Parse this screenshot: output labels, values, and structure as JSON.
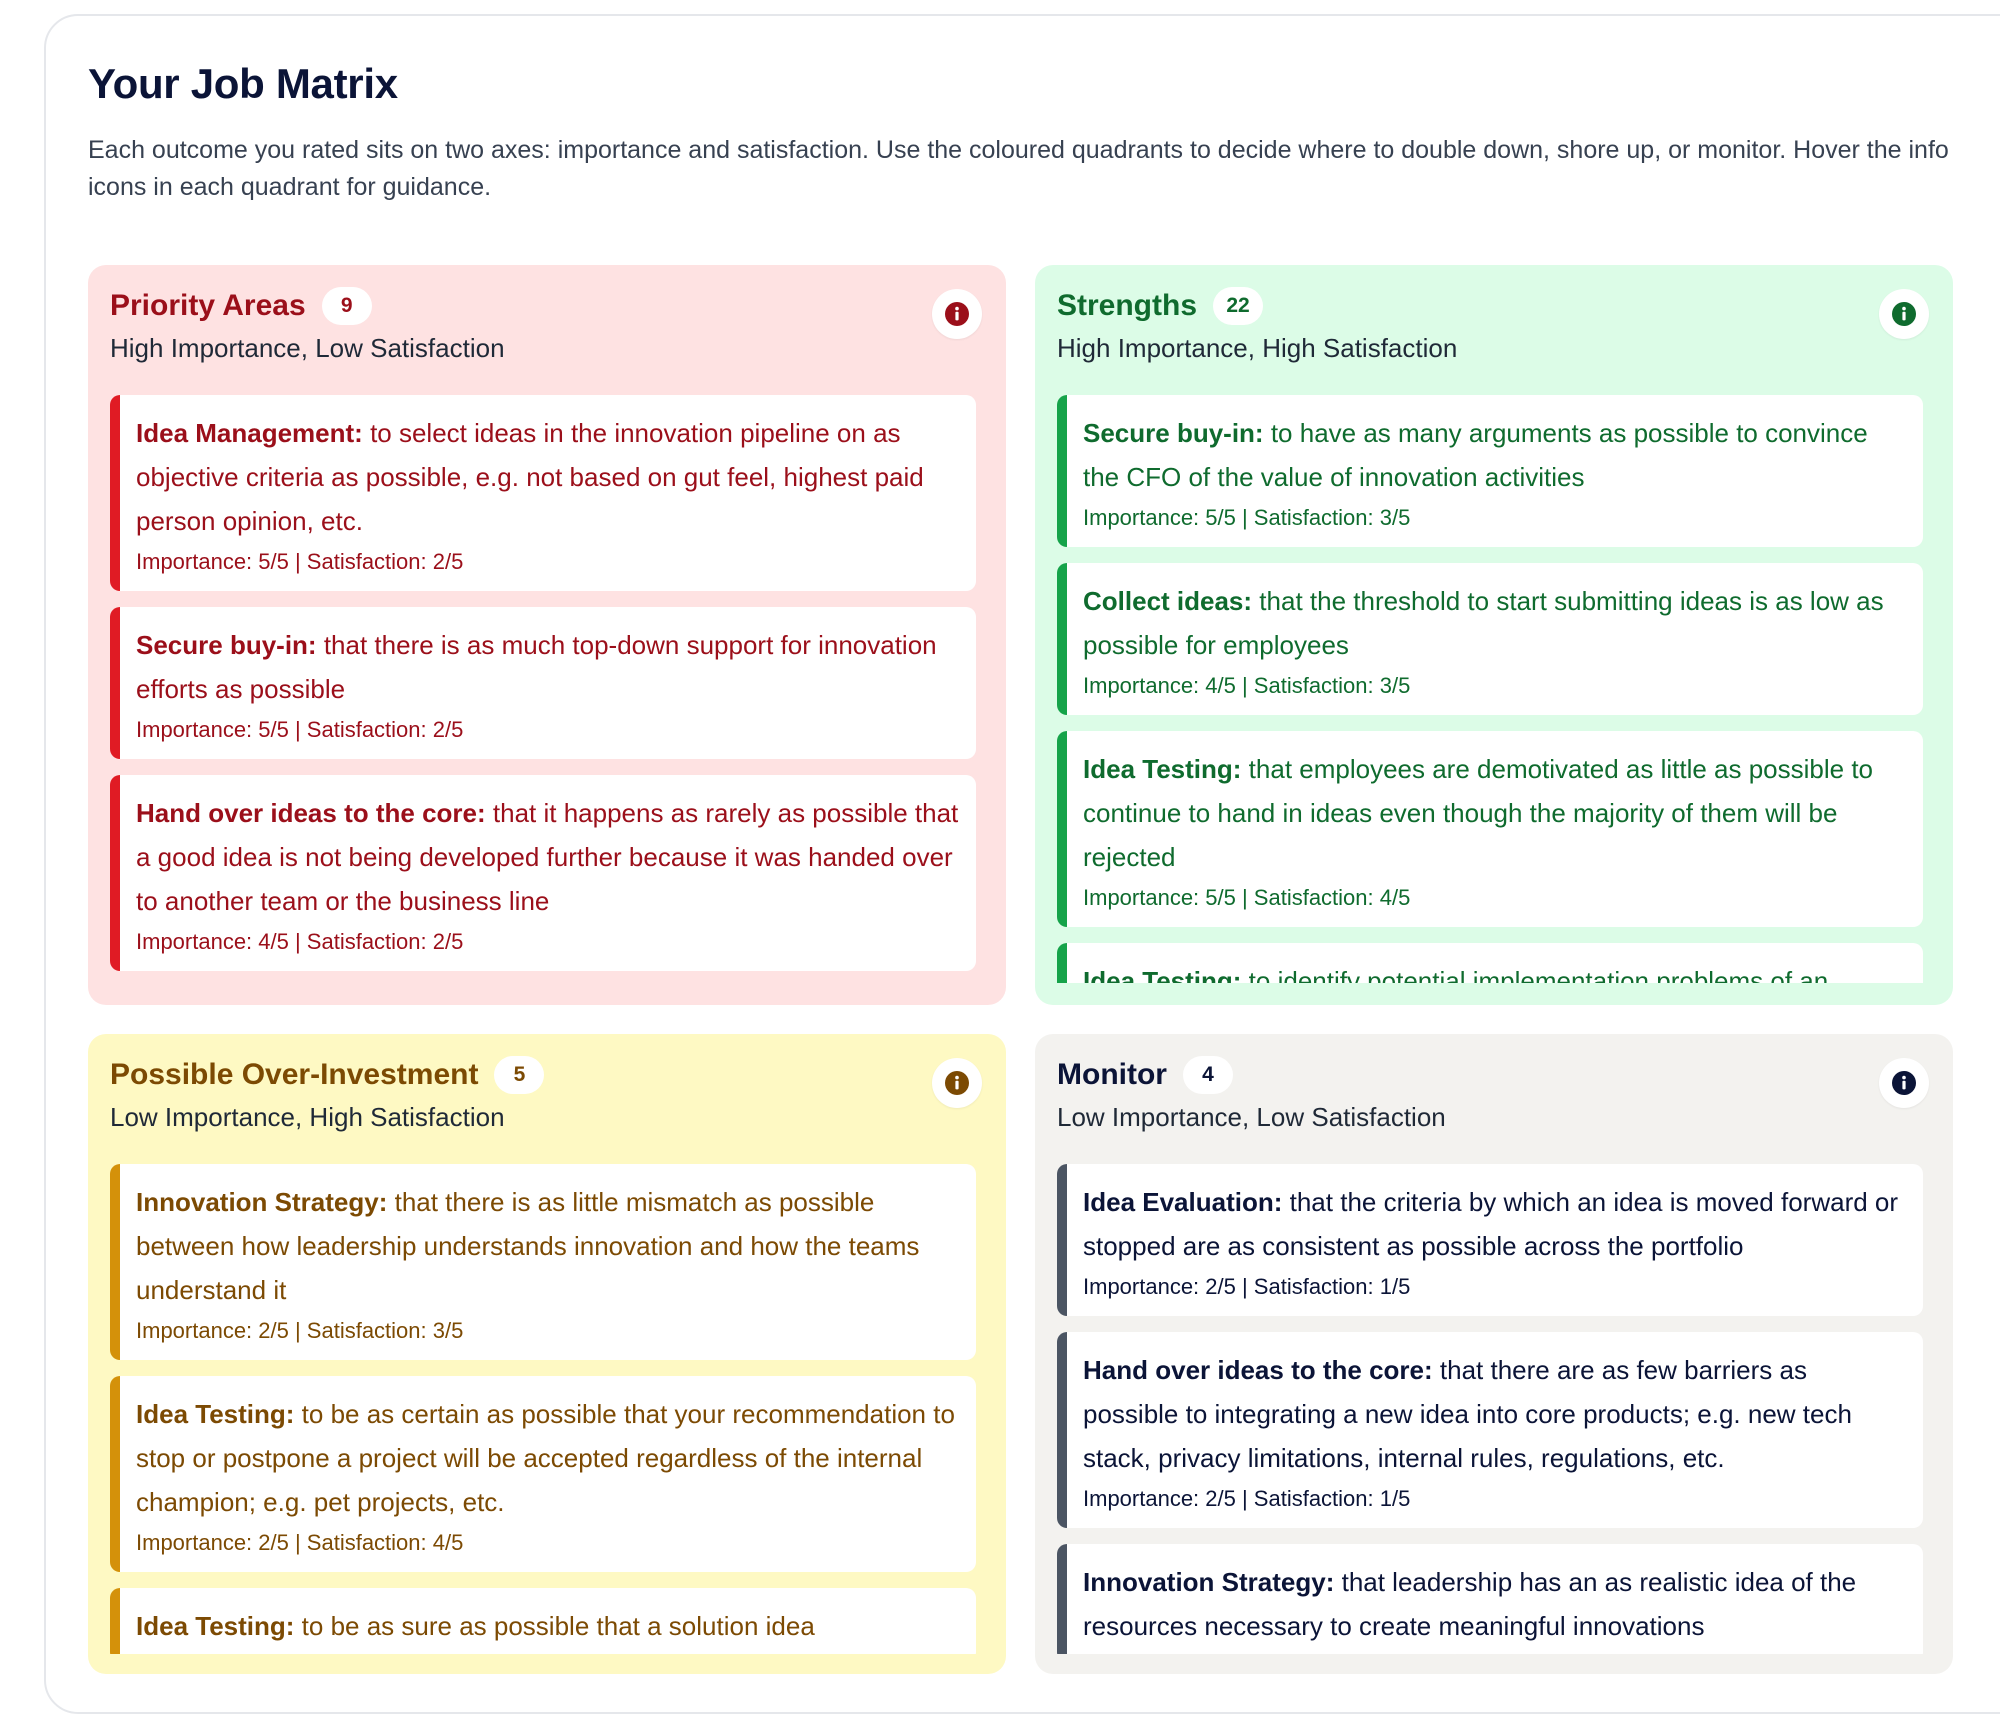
{
  "page": {
    "title": "Your Job Matrix",
    "description": "Each outcome you rated sits on two axes: importance and satisfaction. Use the coloured quadrants to decide where to double down, shore up, or monitor. Hover the info icons in each quadrant for guidance."
  },
  "colors": {
    "priority_bg": "#fee2e2",
    "priority_accent": "#e01b24",
    "priority_text": "#9b0f1a",
    "strength_bg": "#dcfce7",
    "strength_accent": "#16a34a",
    "strength_text": "#0f6b2e",
    "over_bg": "#fef9c3",
    "over_accent": "#d4910a",
    "over_text": "#7c4a03",
    "monitor_bg": "#f3f2ef",
    "monitor_accent": "#4b5563",
    "monitor_text": "#0b1437"
  },
  "quadrants": {
    "priority": {
      "title": "Priority Areas",
      "count": "9",
      "subtitle": "High Importance, Low Satisfaction",
      "icon": "info-icon",
      "items": [
        {
          "title": "Idea Management:",
          "text": "to select ideas in the innovation pipeline on as objective criteria as possible, e.g. not based on gut feel, highest paid person opinion, etc.",
          "meta": "Importance: 5/5 | Satisfaction: 2/5"
        },
        {
          "title": "Secure buy-in:",
          "text": "that there is as much top-down support for innovation efforts as possible",
          "meta": "Importance: 5/5 | Satisfaction: 2/5"
        },
        {
          "title": "Hand over ideas to the core:",
          "text": "that it happens as rarely as possible that a good idea is not being developed further because it was handed over to another team or the business line",
          "meta": "Importance: 4/5 | Satisfaction: 2/5"
        }
      ]
    },
    "strength": {
      "title": "Strengths",
      "count": "22",
      "subtitle": "High Importance, High Satisfaction",
      "icon": "info-icon",
      "items": [
        {
          "title": "Secure buy-in:",
          "text": "to have as many arguments as possible to convince the CFO of the value of innovation activities",
          "meta": "Importance: 5/5 | Satisfaction: 3/5"
        },
        {
          "title": "Collect ideas:",
          "text": "that the threshold to start submitting ideas is as low as possible for employees",
          "meta": "Importance: 4/5 | Satisfaction: 3/5"
        },
        {
          "title": "Idea Testing:",
          "text": "that employees are demotivated as little as possible to continue to hand in ideas even though the majority of them will be rejected",
          "meta": "Importance: 5/5 | Satisfaction: 4/5"
        },
        {
          "title": "Idea Testing:",
          "text": "to identify potential implementation problems of an",
          "meta": ""
        }
      ]
    },
    "over": {
      "title": "Possible Over-Investment",
      "count": "5",
      "subtitle": "Low Importance, High Satisfaction",
      "icon": "info-icon",
      "items": [
        {
          "title": "Innovation Strategy:",
          "text": "that there is as little mismatch as possible between how leadership understands innovation and how the teams understand it",
          "meta": "Importance: 2/5 | Satisfaction: 3/5"
        },
        {
          "title": "Idea Testing:",
          "text": "to be as certain as possible that your recommendation to stop or postpone a project will be accepted regardless of the internal champion; e.g. pet projects, etc.",
          "meta": "Importance: 2/5 | Satisfaction: 4/5"
        },
        {
          "title": "Idea Testing:",
          "text": "to be as sure as possible that a solution idea",
          "meta": ""
        }
      ]
    },
    "monitor": {
      "title": "Monitor",
      "count": "4",
      "subtitle": "Low Importance, Low Satisfaction",
      "icon": "info-icon",
      "items": [
        {
          "title": "Idea Evaluation:",
          "text": "that the criteria by which an idea is moved forward or stopped are as consistent as possible across the portfolio",
          "meta": "Importance: 2/5 | Satisfaction: 1/5"
        },
        {
          "title": "Hand over ideas to the core:",
          "text": "that there are as few barriers as possible to integrating a new idea into core products; e.g. new tech stack, privacy limitations, internal rules, regulations, etc.",
          "meta": "Importance: 2/5 | Satisfaction: 1/5"
        },
        {
          "title": "Innovation Strategy:",
          "text": "that leadership has an as realistic idea of the resources necessary to create meaningful innovations",
          "meta": ""
        }
      ]
    }
  }
}
